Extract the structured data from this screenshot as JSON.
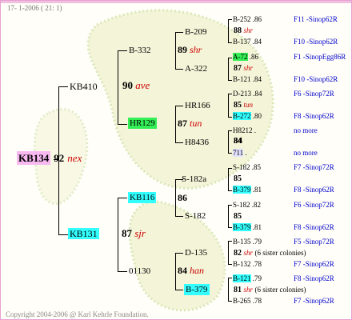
{
  "header": {
    "date_info": "17-  1-2006 ( 21: 1)"
  },
  "footer": {
    "copyright": "Copyright 2004-2006 @ Karl Kehrle Foundation."
  },
  "gen1": {
    "name": "KB134",
    "year": "92",
    "mark": "nex"
  },
  "gen2": [
    {
      "name": "KB410",
      "year": "90",
      "mark": "ave"
    },
    {
      "name": "KB131",
      "year": "87",
      "mark": "sjr"
    }
  ],
  "gen3": [
    {
      "name": "B-332"
    },
    {
      "name": "HR129",
      "year": "87",
      "mark": "tun"
    },
    {
      "name": "KB116",
      "year": "86"
    },
    {
      "name": "01130",
      "year": "84",
      "mark": "han"
    }
  ],
  "gen4": [
    {
      "name": "B-209",
      "year": "89",
      "mark": "shr"
    },
    {
      "name": "A-322"
    },
    {
      "name": "HR166",
      "year": "87",
      "mark": "tun"
    },
    {
      "name": "H8436",
      "year": "84"
    },
    {
      "name": "S-182a",
      "year": "85"
    },
    {
      "name": "S-182"
    },
    {
      "name": "D-135",
      "year": "84",
      "mark": "han"
    },
    {
      "name": "B-379"
    }
  ],
  "gen5": [
    {
      "name": "B-252",
      "code": ".86",
      "year": "88",
      "mark": "shr",
      "dam": "B-137",
      "dam_code": ".84",
      "line1": "F11 -Sinop62R",
      "line2": "F10 -Sinop62R"
    },
    {
      "name": "A-72",
      "code": ".86",
      "year": "87",
      "mark": "shr",
      "dam": "B-121",
      "dam_code": ".84",
      "line1": "F1 -SinopEgg86R",
      "line2": "F10 -Sinop62R"
    },
    {
      "name": "D-213",
      "code": ".84",
      "year": "85",
      "mark": "tun",
      "dam": "B-272",
      "dam_code": ".80",
      "line1": "F6 -Sinop72R",
      "line2": "F8 -Sinop62R"
    },
    {
      "name": "H8212",
      "code": ".",
      "year": "84",
      "mark": "",
      "dam": "711",
      "dam_code": ".",
      "line1": "no more",
      "line2": "no more"
    },
    {
      "name": "S-182",
      "code": ".85",
      "year": "85",
      "mark": "",
      "dam": "B-379",
      "dam_code": ".81",
      "line1": "F7 -Sinop72R",
      "line2": "F8 -Sinop62R"
    },
    {
      "name": "S-182",
      "code": ".82",
      "year": "85",
      "mark": "",
      "dam": "B-379",
      "dam_code": ".81",
      "line1": "F6 -Sinop72R",
      "line2": "F8 -Sinop62R"
    },
    {
      "name": "B-135",
      "code": ".79",
      "year": "82",
      "mark": "shr",
      "note": "(6 sister colonies)",
      "dam": "B-132",
      "dam_code": ".78",
      "line1": "F5 -Sinop72R",
      "line2": "F7 -Sinop62R"
    },
    {
      "name": "B-121",
      "code": ".79",
      "year": "81",
      "mark": "shr",
      "note": "(6 sister colonies)",
      "dam": "B-265",
      "dam_code": ".78",
      "line1": "F8 -Sinop62R",
      "line2": "F7 -Sinop62R"
    }
  ]
}
